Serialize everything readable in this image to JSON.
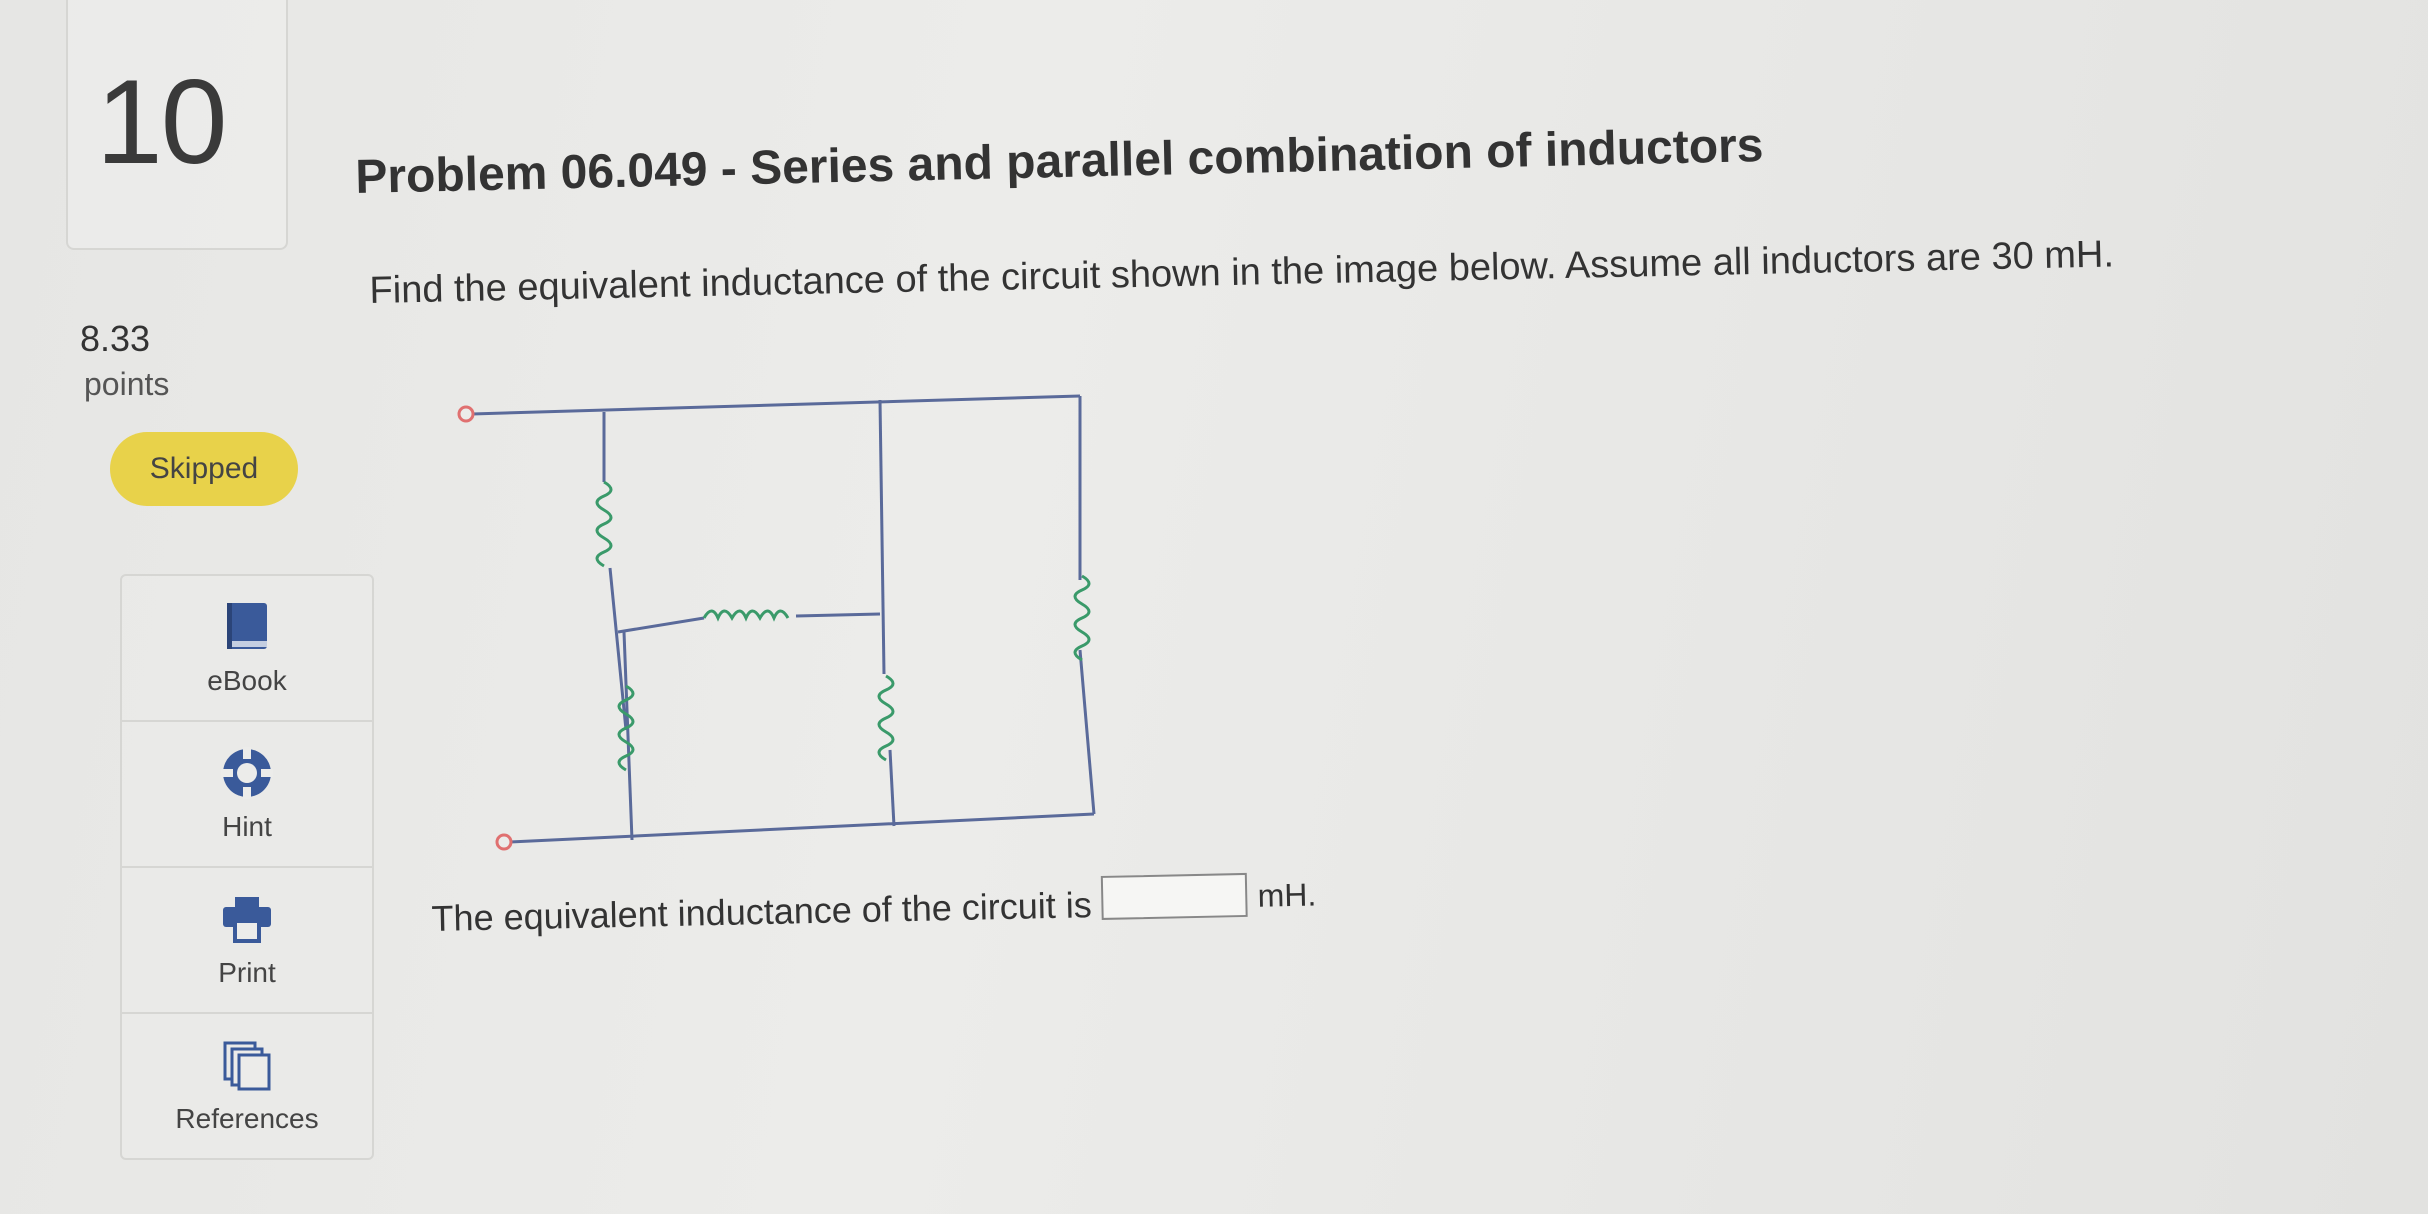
{
  "question": {
    "number": "10",
    "points_value": "8.33",
    "points_label": "points",
    "status": "Skipped",
    "title": "Problem 06.049 - Series and parallel combination of inductors",
    "prompt": "Find the equivalent inductance of the circuit shown in the image below. Assume all inductors are 30 mH.",
    "answer_prefix": "The equivalent inductance of the circuit is",
    "answer_value": "",
    "answer_unit": "mH."
  },
  "tools": [
    {
      "label": "eBook",
      "icon": "book-icon"
    },
    {
      "label": "Hint",
      "icon": "lifebuoy-icon"
    },
    {
      "label": "Print",
      "icon": "printer-icon"
    },
    {
      "label": "References",
      "icon": "documents-icon"
    }
  ],
  "colors": {
    "badge": "#e8d24a",
    "wire": "#5a6a9a",
    "inductor": "#3a9a6a",
    "terminal": "#e07070",
    "icon": "#3a5a9a"
  }
}
